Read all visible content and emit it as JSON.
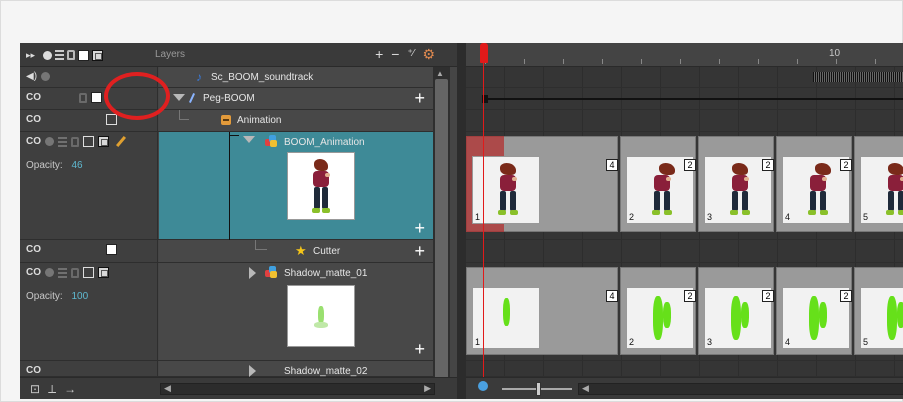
{
  "layers_panel": {
    "title": "Layers",
    "actions": [
      "+",
      "−",
      "⁺⁄",
      "⚙"
    ],
    "footer_icons": [
      "⊡",
      "⟂",
      "→"
    ]
  },
  "layers": [
    {
      "name": "Sc_BOOM_soundtrack"
    },
    {
      "name": "Peg-BOOM"
    },
    {
      "name": "Animation"
    },
    {
      "name": "BOOM_Animation",
      "opacity_label": "Opacity:",
      "opacity_value": "46"
    },
    {
      "name": "Cutter"
    },
    {
      "name": "Shadow_matte_01",
      "opacity_label": "Opacity:",
      "opacity_value": "100"
    },
    {
      "name": "Shadow_matte_02"
    }
  ],
  "timeline": {
    "ruler_label": "10",
    "current_frame": 1,
    "boom_frames": [
      {
        "label": "1",
        "hold": ""
      },
      {
        "label": "2",
        "hold": "4"
      },
      {
        "label": "3",
        "hold": "2"
      },
      {
        "label": "4",
        "hold": "2"
      },
      {
        "label": "5",
        "hold": "2"
      }
    ],
    "matte_frames": [
      {
        "label": "1",
        "hold": ""
      },
      {
        "label": "2",
        "hold": "4"
      },
      {
        "label": "3",
        "hold": "2"
      },
      {
        "label": "4",
        "hold": "2"
      },
      {
        "label": "5",
        "hold": "2"
      }
    ]
  },
  "colors": {
    "selected_layer": "#3e8a97",
    "playhead": "#e11a1a",
    "annotation_circle": "#e02020",
    "opacity_value": "#5fb9d0"
  }
}
